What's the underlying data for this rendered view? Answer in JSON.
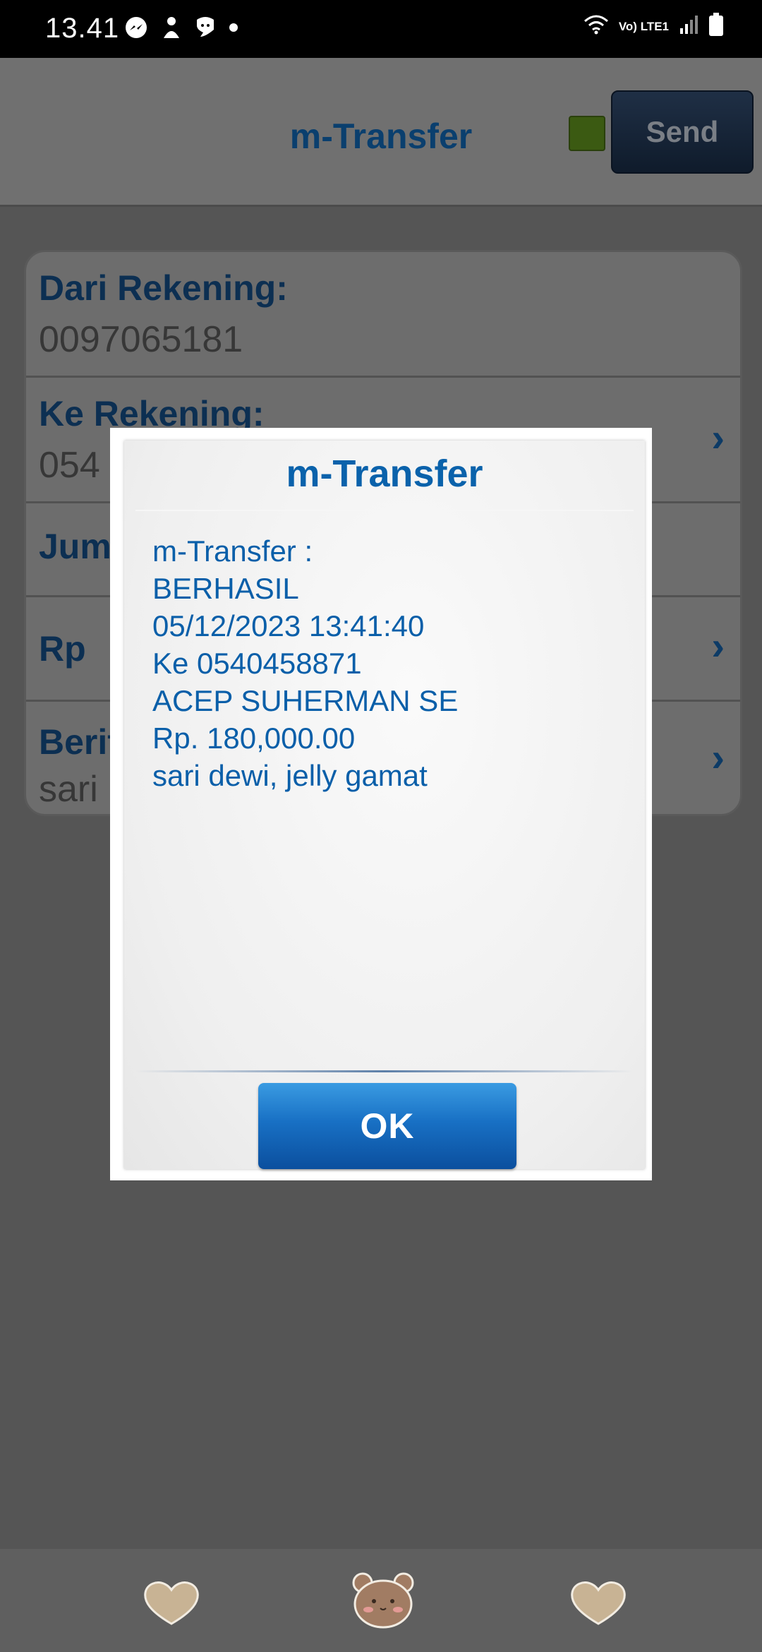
{
  "status_bar": {
    "time": "13.41",
    "network_label": "Vo) LTE1"
  },
  "screen": {
    "title": "m-Transfer",
    "send_label": "Send",
    "fields": [
      {
        "label": "Dari Rekening:",
        "value": "0097065181"
      },
      {
        "label": "Ke Rekening:",
        "value": "054"
      },
      {
        "label": "Jum",
        "value": ""
      },
      {
        "label": "Rp",
        "value": ""
      },
      {
        "label": "Berit",
        "value": "sari"
      }
    ]
  },
  "dialog": {
    "title": "m-Transfer",
    "lines": [
      "m-Transfer :",
      "BERHASIL",
      "05/12/2023 13:41:40",
      "Ke 0540458871",
      "ACEP SUHERMAN SE",
      "Rp. 180,000.00",
      "sari dewi, jelly gamat"
    ],
    "ok_label": "OK"
  },
  "colors": {
    "accent_blue": "#0a62ab",
    "status_indicator": "#5aa21c",
    "overlay": "#555555"
  }
}
